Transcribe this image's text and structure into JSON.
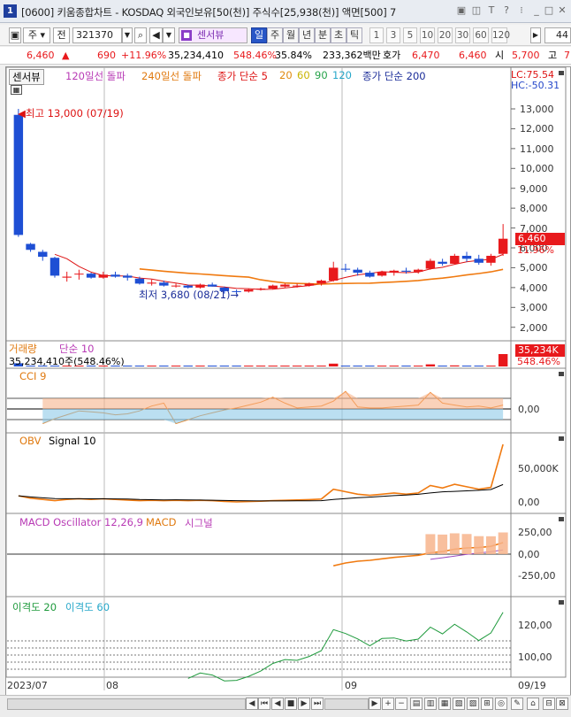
{
  "titlebar": {
    "title": "[0600] 키움종합차트 - KOSDAQ 외국인보유[50(천)] 주식수[25,938(천)] 액면[500] 7"
  },
  "toolbar": {
    "type_label": "주",
    "prev_label": "전",
    "code": "321370",
    "sensor_label": "센서뷰",
    "periods": [
      "일",
      "주",
      "월",
      "년",
      "분",
      "초",
      "틱"
    ],
    "numbers": [
      "1",
      "3",
      "5",
      "10",
      "20",
      "30",
      "60",
      "120"
    ],
    "count": "44"
  },
  "pricebar": {
    "price": "6,460",
    "arrow": "▲",
    "change": "690",
    "change_pct": "+11.96%",
    "volume": "35,234,410",
    "vol_ratio": "548.46%",
    "turnover": "35.84%",
    "amount": "233,362백만",
    "ask_label": "호가",
    "ask": "6,470",
    "bid": "6,460",
    "open_label": "시",
    "open": "5,700",
    "high_label": "고",
    "high_tail": "7"
  },
  "price_panel": {
    "legend": {
      "sensor": "센서뷰",
      "ma120": "120일선 돌파",
      "ma240": "240일선 돌파",
      "ma_label": "종가 단순 5",
      "p20": "20",
      "p60": "60",
      "p90": "90",
      "p120": "120",
      "ma200": "종가 단순 200"
    },
    "lc": "LC:75.54",
    "hc": "HC:-50.31",
    "high_note": "최고 13,000 (07/19)",
    "low_note": "최저 3,680 (08/21)",
    "yticks": [
      "13,000",
      "12,000",
      "11,000",
      "10,000",
      "9,000",
      "8,000",
      "7,000",
      "6,000",
      "5,000",
      "4,000",
      "3,000",
      "2,000"
    ],
    "current_price": "6,460",
    "current_pct": "11.96%"
  },
  "volume_panel": {
    "legend": "거래량",
    "legend2": "단순 10",
    "readout": "35,234,410주(548.46%)",
    "last_value": "35,234K",
    "last_pct": "548.46%"
  },
  "cci_panel": {
    "legend": "CCI 9",
    "yticks": [
      "0,00"
    ]
  },
  "obv_panel": {
    "legend": "OBV",
    "legend2": "Signal 10",
    "yticks": [
      "50,000K",
      "0,00"
    ]
  },
  "macd_panel": {
    "legend": "MACD Oscillator 12,26,9",
    "legend2": "MACD",
    "legend3": "시그널",
    "yticks": [
      "250,00",
      "0,00",
      "-250,00"
    ]
  },
  "disp_panel": {
    "legend": "이격도 20",
    "legend2": "이격도 60",
    "yticks": [
      "120,00",
      "100,00"
    ]
  },
  "xaxis": {
    "labels": [
      "2023/07",
      "08",
      "09",
      "09/19"
    ]
  },
  "colors": {
    "up": "#e8191c",
    "down": "#1e4fd4",
    "orange": "#f07a10",
    "green": "#1e9a3c",
    "accent": "#2957c7"
  },
  "chart_data": {
    "type": "candlestick",
    "x_start": "2023/07",
    "x_end": "09/19",
    "ylim": [
      2000,
      13500
    ],
    "candles": [
      {
        "o": 12700,
        "h": 13000,
        "l": 6550,
        "c": 6650
      },
      {
        "o": 6200,
        "h": 6250,
        "l": 5800,
        "c": 5900
      },
      {
        "o": 5800,
        "h": 5900,
        "l": 5350,
        "c": 5550
      },
      {
        "o": 5500,
        "h": 5550,
        "l": 4500,
        "c": 4600
      },
      {
        "o": 4500,
        "h": 4800,
        "l": 4300,
        "c": 4550
      },
      {
        "o": 4700,
        "h": 4900,
        "l": 4400,
        "c": 4700
      },
      {
        "o": 4700,
        "h": 4750,
        "l": 4450,
        "c": 4500
      },
      {
        "o": 4500,
        "h": 4800,
        "l": 4450,
        "c": 4650
      },
      {
        "o": 4650,
        "h": 4800,
        "l": 4500,
        "c": 4550
      },
      {
        "o": 4600,
        "h": 4700,
        "l": 4350,
        "c": 4500
      },
      {
        "o": 4450,
        "h": 4550,
        "l": 4150,
        "c": 4200
      },
      {
        "o": 4200,
        "h": 4400,
        "l": 4100,
        "c": 4250
      },
      {
        "o": 4250,
        "h": 4350,
        "l": 4050,
        "c": 4100
      },
      {
        "o": 4100,
        "h": 4200,
        "l": 4000,
        "c": 4100
      },
      {
        "o": 4100,
        "h": 4150,
        "l": 3950,
        "c": 4000
      },
      {
        "o": 4000,
        "h": 4200,
        "l": 3950,
        "c": 4150
      },
      {
        "o": 4150,
        "h": 4250,
        "l": 4050,
        "c": 4050
      },
      {
        "o": 4000,
        "h": 4050,
        "l": 3700,
        "c": 3820
      },
      {
        "o": 3820,
        "h": 3900,
        "l": 3680,
        "c": 3800
      },
      {
        "o": 3800,
        "h": 3950,
        "l": 3750,
        "c": 3900
      },
      {
        "o": 3900,
        "h": 4000,
        "l": 3850,
        "c": 3950
      },
      {
        "o": 3950,
        "h": 4150,
        "l": 3900,
        "c": 4100
      },
      {
        "o": 4050,
        "h": 4200,
        "l": 4000,
        "c": 4150
      },
      {
        "o": 4100,
        "h": 4200,
        "l": 4000,
        "c": 4100
      },
      {
        "o": 4100,
        "h": 4250,
        "l": 4050,
        "c": 4200
      },
      {
        "o": 4200,
        "h": 4400,
        "l": 4100,
        "c": 4350
      },
      {
        "o": 4350,
        "h": 5300,
        "l": 4300,
        "c": 5000
      },
      {
        "o": 4950,
        "h": 5200,
        "l": 4800,
        "c": 4900
      },
      {
        "o": 4900,
        "h": 5000,
        "l": 4600,
        "c": 4750
      },
      {
        "o": 4750,
        "h": 4850,
        "l": 4500,
        "c": 4550
      },
      {
        "o": 4600,
        "h": 4850,
        "l": 4550,
        "c": 4800
      },
      {
        "o": 4750,
        "h": 4900,
        "l": 4600,
        "c": 4850
      },
      {
        "o": 4850,
        "h": 5000,
        "l": 4700,
        "c": 4800
      },
      {
        "o": 4800,
        "h": 4950,
        "l": 4700,
        "c": 4900
      },
      {
        "o": 4950,
        "h": 5450,
        "l": 4900,
        "c": 5350
      },
      {
        "o": 5300,
        "h": 5450,
        "l": 5100,
        "c": 5200
      },
      {
        "o": 5200,
        "h": 5700,
        "l": 5150,
        "c": 5600
      },
      {
        "o": 5600,
        "h": 5800,
        "l": 5300,
        "c": 5450
      },
      {
        "o": 5450,
        "h": 5650,
        "l": 5150,
        "c": 5250
      },
      {
        "o": 5250,
        "h": 5700,
        "l": 5100,
        "c": 5600
      },
      {
        "o": 5700,
        "h": 7200,
        "l": 5600,
        "c": 6460
      }
    ],
    "volume": [
      9,
      2,
      1,
      1,
      1,
      0.5,
      0.5,
      0.5,
      0.5,
      0.5,
      0.5,
      0.3,
      0.3,
      0.3,
      0.3,
      0.3,
      0.3,
      0.6,
      0.4,
      0.3,
      0.3,
      0.4,
      0.3,
      0.3,
      0.3,
      0.4,
      8,
      2,
      2,
      1,
      1,
      1,
      1,
      1,
      6,
      2,
      3,
      2,
      2,
      1.5,
      35
    ],
    "cci": [
      null,
      null,
      null,
      null,
      null,
      null,
      null,
      null,
      null,
      null,
      null,
      null,
      null,
      null,
      -10,
      -20,
      -150,
      -100,
      -60,
      -20,
      -30,
      -40,
      -60,
      -50,
      -20,
      30,
      60,
      -150,
      -110,
      -70,
      -40,
      -10,
      10,
      40,
      70,
      120,
      60,
      10,
      20,
      30,
      80,
      180,
      20,
      10,
      10,
      20,
      30,
      40,
      170,
      60,
      40,
      20,
      30,
      10,
      40,
      140
    ]
  }
}
